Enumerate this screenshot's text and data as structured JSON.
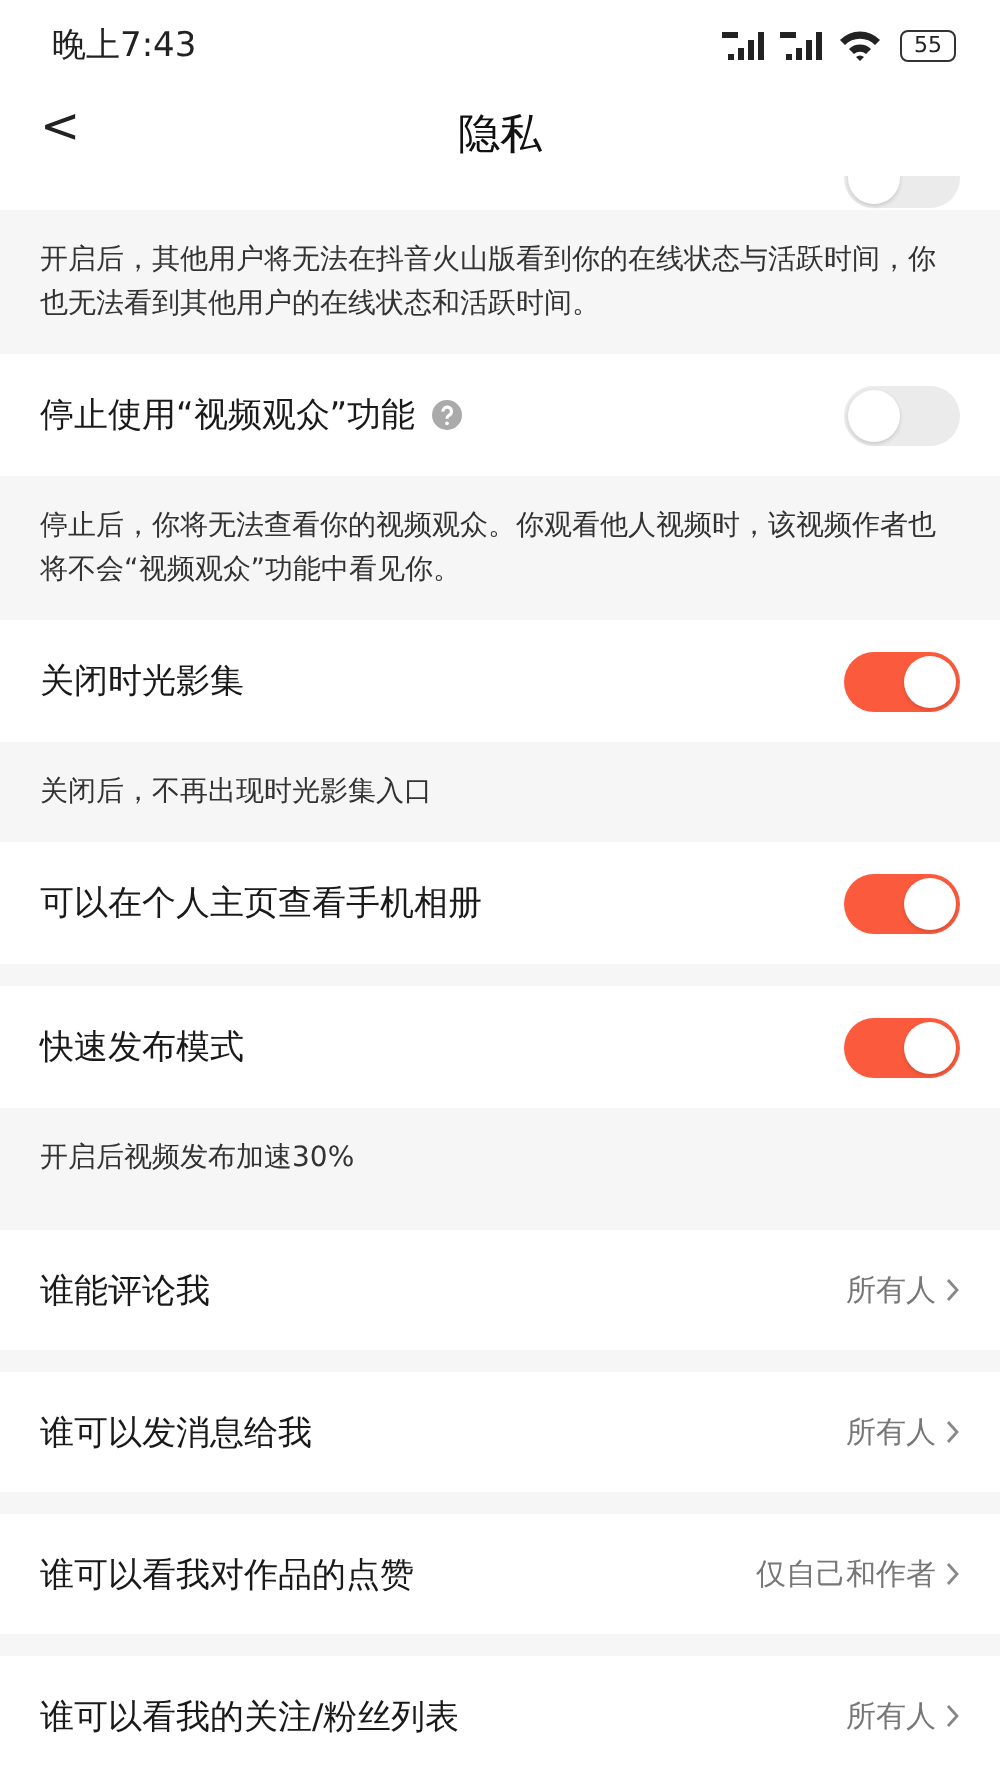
{
  "status_bar": {
    "time": "晚上7:43",
    "battery": "55"
  },
  "header": {
    "back": "<",
    "title": "隐私"
  },
  "items": [
    {
      "kind": "clipped_toggle",
      "on": false
    },
    {
      "kind": "note",
      "text": "开启后，其他用户将无法在抖音火山版看到你的在线状态与活跃时间，你也无法看到其他用户的在线状态和活跃时间。"
    },
    {
      "kind": "toggle",
      "label": "停止使用“视频观众”功能",
      "help": true,
      "on": false
    },
    {
      "kind": "note",
      "text": "停止后，你将无法查看你的视频观众。你观看他人视频时，该视频作者也将不会“视频观众”功能中看见你。"
    },
    {
      "kind": "toggle",
      "label": "关闭时光影集",
      "help": false,
      "on": true
    },
    {
      "kind": "note",
      "text": "关闭后，不再出现时光影集入口"
    },
    {
      "kind": "toggle",
      "label": "可以在个人主页查看手机相册",
      "help": false,
      "on": true
    },
    {
      "kind": "gap"
    },
    {
      "kind": "toggle",
      "label": "快速发布模式",
      "help": false,
      "on": true
    },
    {
      "kind": "note",
      "text": "开启后视频发布加速30%"
    },
    {
      "kind": "gap"
    },
    {
      "kind": "link",
      "label": "谁能评论我",
      "value": "所有人"
    },
    {
      "kind": "gap"
    },
    {
      "kind": "link",
      "label": "谁可以发消息给我",
      "value": "所有人"
    },
    {
      "kind": "gap"
    },
    {
      "kind": "link",
      "label": "谁可以看我对作品的点赞",
      "value": "仅自己和作者"
    },
    {
      "kind": "gap"
    },
    {
      "kind": "link",
      "label": "谁可以看我的关注/粉丝列表",
      "value": "所有人"
    }
  ]
}
